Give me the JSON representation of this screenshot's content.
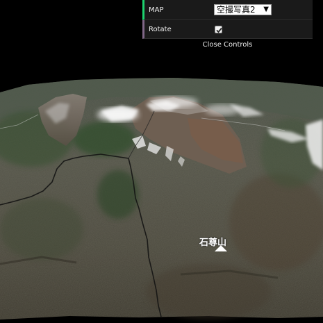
{
  "controls": {
    "map_label": "MAP",
    "map_selected": "空撮写真2",
    "rotate_label": "Rotate",
    "rotate_checked": true,
    "close_label": "Close Controls"
  },
  "map_overlay": {
    "place_label": "石尊山"
  },
  "colors": {
    "map_row_accent": "#1ed36f",
    "rotate_row_accent": "#806787",
    "panel_bg": "#1a1a1a",
    "background": "#000000"
  },
  "icons": {
    "select_arrow": "triangle-down-icon",
    "checkbox": "checkmark-icon",
    "place_marker": "triangle-up-marker-icon"
  }
}
